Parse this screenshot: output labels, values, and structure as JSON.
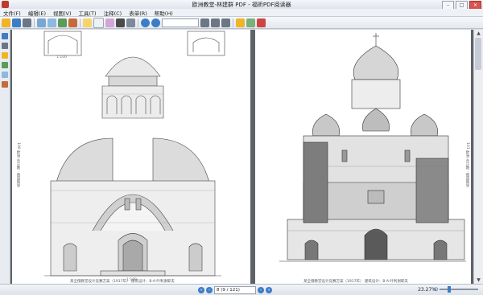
{
  "window": {
    "title": "欧洲教堂-林建群 PDF - 福昕PDF阅读器",
    "min": "–",
    "max": "□",
    "close": "✕"
  },
  "menu": [
    "文件(F)",
    "编辑(E)",
    "视图(V)",
    "工具(T)",
    "注释(C)",
    "表单(R)",
    "帮助(H)"
  ],
  "toolbar": {
    "zoom_value": ""
  },
  "pages": {
    "left": {
      "caption": "某全俄教堂设计竞赛方案（1917年） 建筑设计：B·A·叶利谢耶夫",
      "side_text": "100 欧洲·东正教 · 俄国教堂",
      "label_top": "1:100",
      "label_bottom": "1:100"
    },
    "right": {
      "caption": "某全俄教堂设计竞赛方案（1917年） 建筑设计：B·A·叶利谢耶夫",
      "side_text": "101 欧洲·东正教 · 俄国教堂"
    }
  },
  "status": {
    "page_field": "8 (9 / 121)",
    "zoom": "23.27%"
  },
  "colors": {
    "accent": "#3c7dc6",
    "frame": "#5f6368"
  }
}
